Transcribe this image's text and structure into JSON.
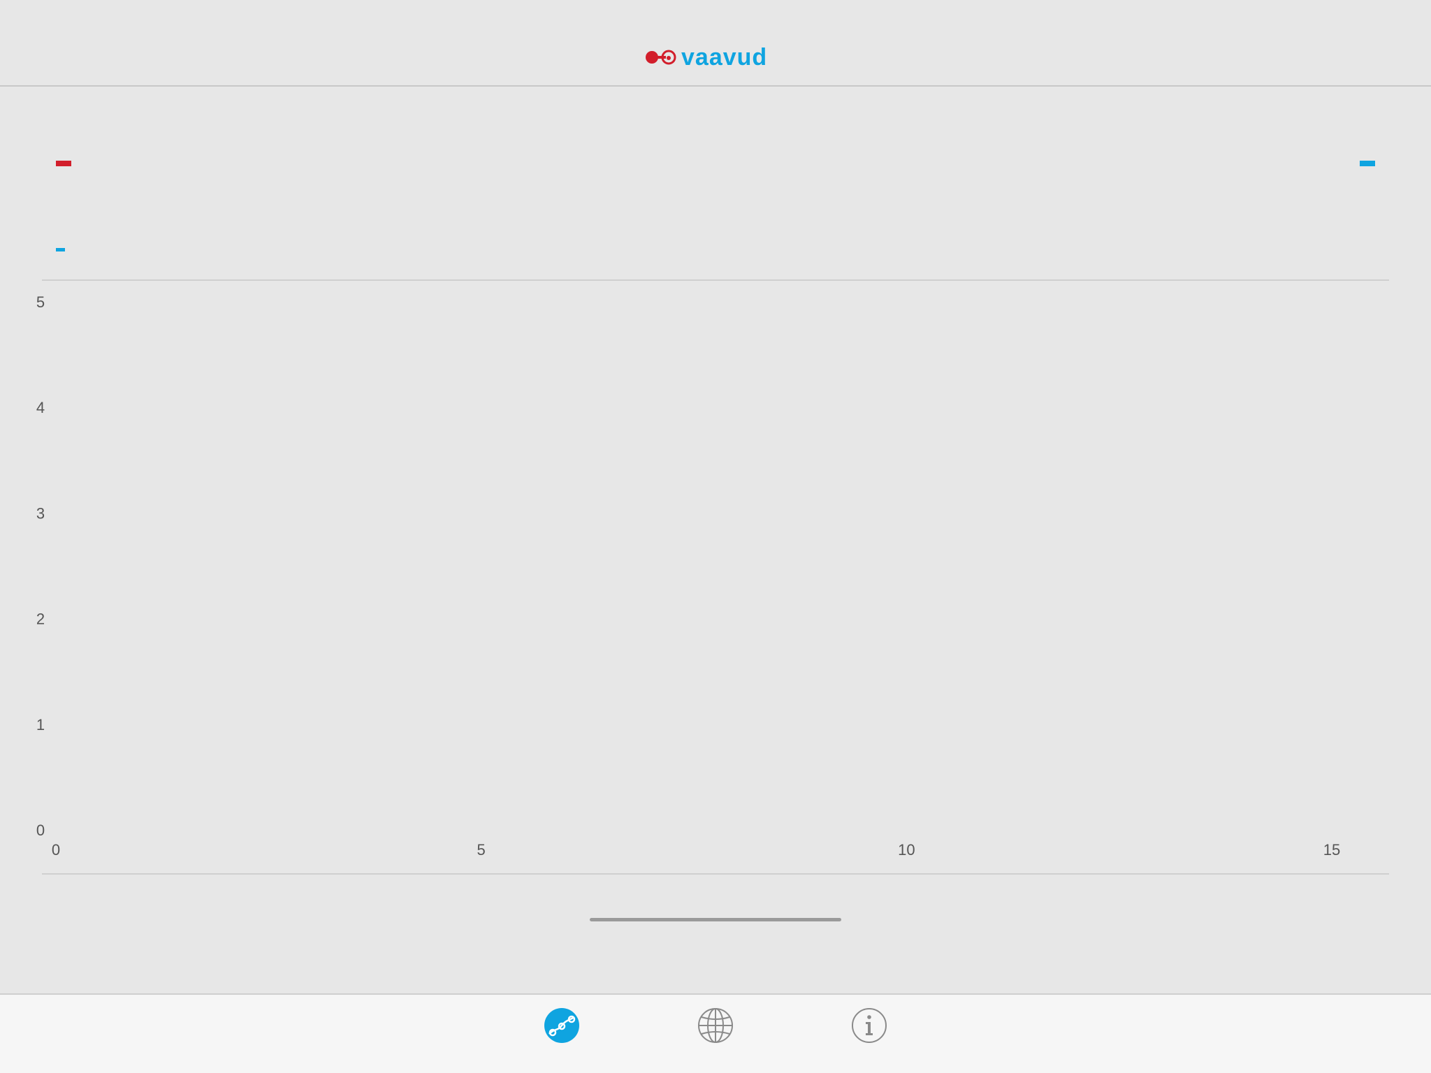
{
  "app": {
    "title": "vaavud"
  },
  "colors": {
    "brand_red": "#d21e2b",
    "brand_blue": "#0fa4e0",
    "background": "#e7e7e7",
    "tabbar_bg": "#f6f6f6",
    "icon_gray": "#8a8a8a"
  },
  "header": {
    "logo_text": "vaavud",
    "logo_icon": "vaavud-logo-icon"
  },
  "readout": {
    "left_value": "–",
    "right_value": "–",
    "sub_value": "–"
  },
  "chart_data": {
    "type": "line",
    "title": "",
    "xlabel": "",
    "ylabel": "",
    "x_ticks": [
      "0",
      "5",
      "10",
      "15"
    ],
    "y_ticks": [
      "0",
      "1",
      "2",
      "3",
      "4",
      "5"
    ],
    "xlim": [
      0,
      15
    ],
    "ylim": [
      0,
      5
    ],
    "grid": false,
    "series": []
  },
  "tabbar": {
    "tabs": [
      {
        "id": "measure",
        "icon": "measure-icon",
        "active": true
      },
      {
        "id": "map",
        "icon": "globe-icon",
        "active": false
      },
      {
        "id": "info",
        "icon": "info-icon",
        "active": false
      }
    ]
  }
}
